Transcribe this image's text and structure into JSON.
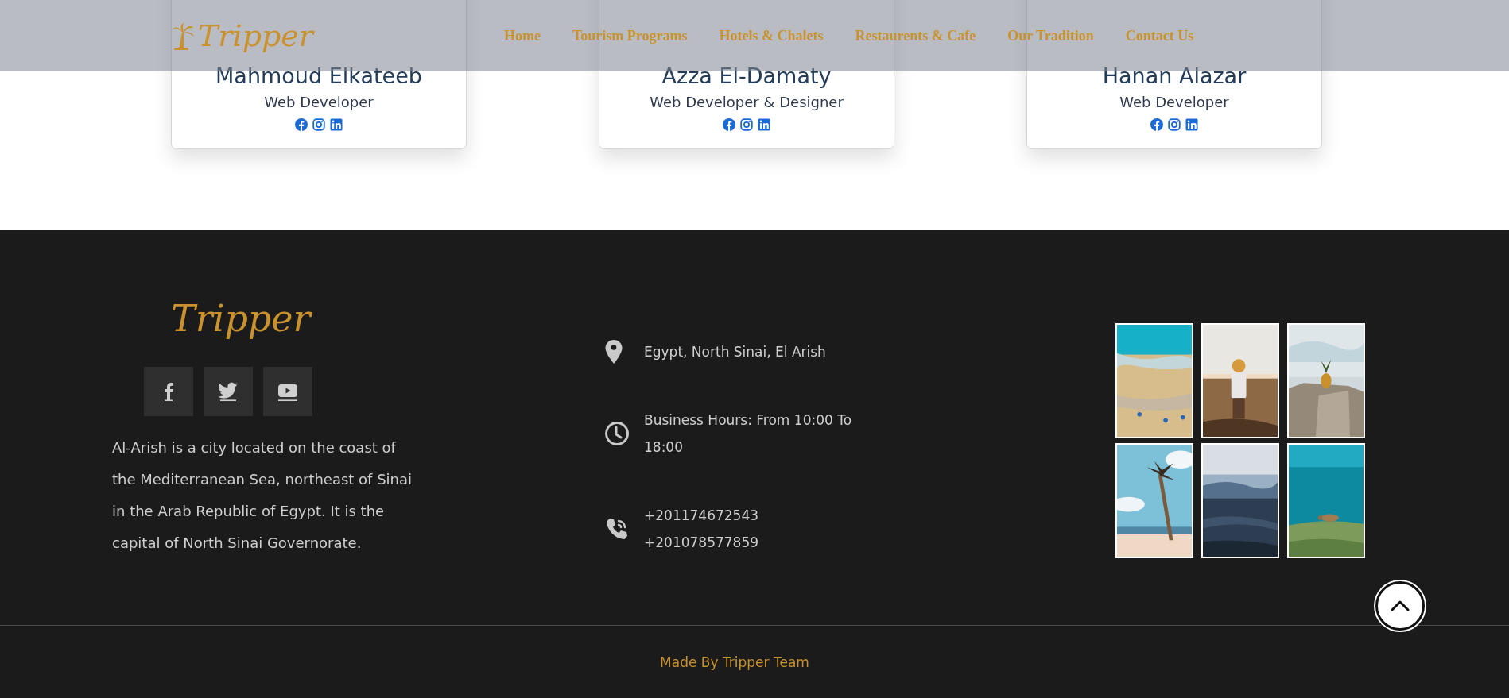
{
  "team_members": [
    {
      "name": "Mahmoud Elkateeb",
      "role": "Web Developer",
      "social_links": [
        {
          "kind": "facebook"
        },
        {
          "kind": "instagram"
        },
        {
          "kind": "linkedin"
        }
      ]
    },
    {
      "name": "Azza El-Damaty",
      "role": "Web Developer & Designer",
      "social_links": [
        {
          "kind": "facebook"
        },
        {
          "kind": "instagram"
        },
        {
          "kind": "linkedin"
        }
      ]
    },
    {
      "name": "Hanan Alazar",
      "role": "Web Developer",
      "social_links": [
        {
          "kind": "facebook"
        },
        {
          "kind": "instagram"
        },
        {
          "kind": "linkedin"
        }
      ]
    }
  ],
  "navbar": {
    "logo": "Tripper",
    "links": [
      {
        "label": "Home"
      },
      {
        "label": "Tourism Programs"
      },
      {
        "label": "Hotels & Chalets"
      },
      {
        "label": "Restaurents & Cafe"
      },
      {
        "label": "Our Tradition"
      },
      {
        "label": "Contact Us"
      }
    ]
  },
  "footer": {
    "logo": "Tripper",
    "social_links": [
      {
        "kind": "facebook"
      },
      {
        "kind": "twitter"
      },
      {
        "kind": "youtube"
      }
    ],
    "about": "Al-Arish is a city located on the coast of the Mediterranean Sea, northeast of Sinai in the Arab Republic of Egypt. It is the capital of North Sinai Governorate.",
    "contacts": [
      {
        "kind": "location",
        "lines": [
          "Egypt, North Sinai, El Arish"
        ]
      },
      {
        "kind": "hours",
        "lines": [
          "Business Hours: From 10:00 To 18:00"
        ]
      },
      {
        "kind": "phone",
        "lines": [
          "+201174672543",
          "+201078577859"
        ]
      }
    ],
    "copyright": "Made By Tripper Team"
  }
}
